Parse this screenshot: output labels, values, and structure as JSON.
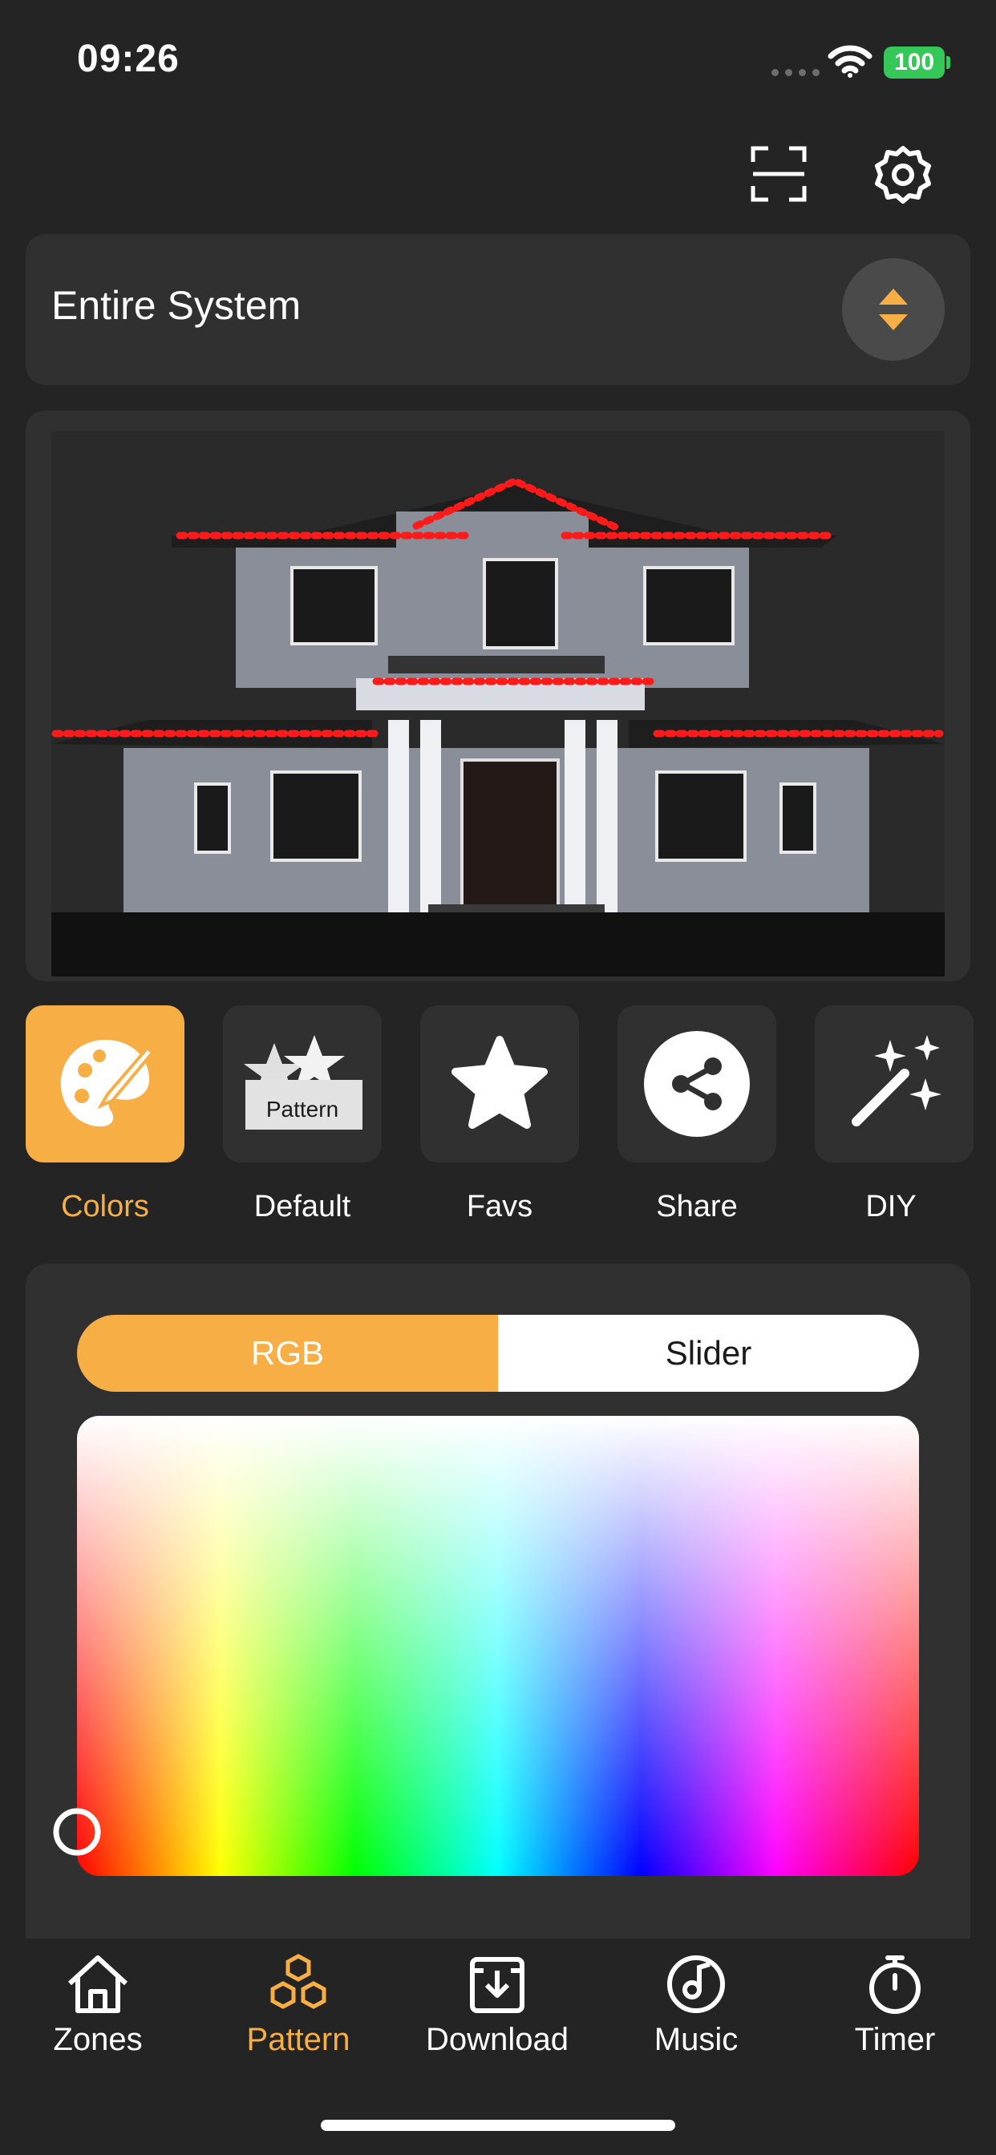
{
  "status_bar": {
    "time": "09:26",
    "battery": "100"
  },
  "header": {
    "scan_icon": "scan-icon",
    "settings_icon": "gear-icon"
  },
  "zone": {
    "title": "Entire System"
  },
  "modes": [
    {
      "label": "Colors",
      "icon": "palette-icon",
      "active": true
    },
    {
      "label": "Default",
      "icon": "pattern-box-icon",
      "badge": "Pattern"
    },
    {
      "label": "Favs",
      "icon": "star-icon"
    },
    {
      "label": "Share",
      "icon": "share-icon"
    },
    {
      "label": "DIY",
      "icon": "magic-wand-icon"
    }
  ],
  "color_panel": {
    "tabs": {
      "rgb": "RGB",
      "slider": "Slider"
    },
    "active_tab": "RGB"
  },
  "tabbar": [
    {
      "label": "Zones",
      "icon": "home-icon"
    },
    {
      "label": "Pattern",
      "icon": "hexagons-icon",
      "active": true
    },
    {
      "label": "Download",
      "icon": "download-icon"
    },
    {
      "label": "Music",
      "icon": "music-icon"
    },
    {
      "label": "Timer",
      "icon": "timer-icon"
    }
  ],
  "colors": {
    "accent": "#f7ae45",
    "background": "#242424",
    "card": "#303030",
    "led": "#ff1a1a"
  }
}
